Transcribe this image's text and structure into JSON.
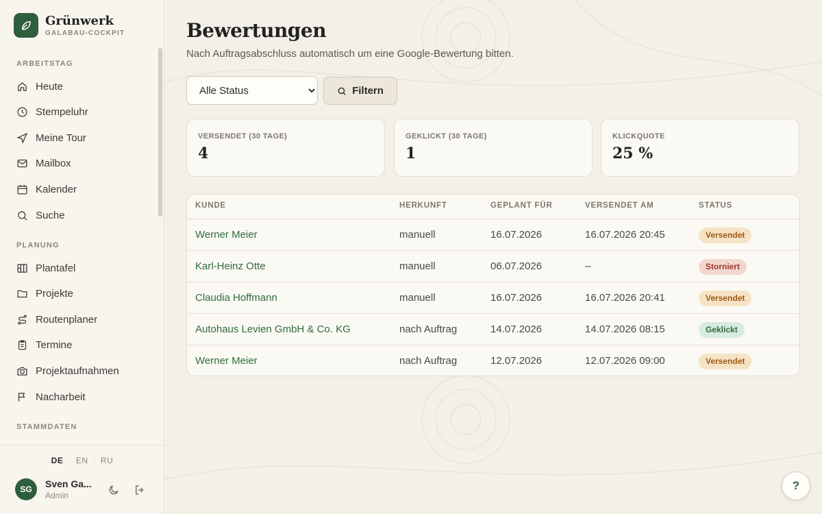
{
  "brand": {
    "name": "Grünwerk",
    "subtitle": "GALABAU-COCKPIT"
  },
  "sidebar": {
    "sections": [
      {
        "label": "ARBEITSTAG",
        "items": [
          "Heute",
          "Stempeluhr",
          "Meine Tour",
          "Mailbox",
          "Kalender",
          "Suche"
        ]
      },
      {
        "label": "PLANUNG",
        "items": [
          "Plantafel",
          "Projekte",
          "Routenplaner",
          "Termine",
          "Projektaufnahmen",
          "Nacharbeit"
        ]
      },
      {
        "label": "STAMMDATEN",
        "items": []
      }
    ],
    "languages": [
      "DE",
      "EN",
      "RU"
    ],
    "active_language": "DE",
    "user": {
      "initials": "SG",
      "name": "Sven Ga...",
      "role": "Admin"
    }
  },
  "page": {
    "title": "Bewertungen",
    "subtitle": "Nach Auftragsabschluss automatisch um eine Google-Bewertung bitten.",
    "filter": {
      "select_value": "Alle Status",
      "button_label": "Filtern"
    }
  },
  "stats": [
    {
      "label": "VERSENDET (30 TAGE)",
      "value": "4"
    },
    {
      "label": "GEKLICKT (30 TAGE)",
      "value": "1"
    },
    {
      "label": "KLICKQUOTE",
      "value": "25 %"
    }
  ],
  "table": {
    "columns": [
      "KUNDE",
      "HERKUNFT",
      "GEPLANT FÜR",
      "VERSENDET AM",
      "STATUS"
    ],
    "rows": [
      {
        "kunde": "Werner Meier",
        "herkunft": "manuell",
        "geplant": "16.07.2026",
        "versendet": "16.07.2026 20:45",
        "status": "Versendet"
      },
      {
        "kunde": "Karl-Heinz Otte",
        "herkunft": "manuell",
        "geplant": "06.07.2026",
        "versendet": "–",
        "status": "Storniert"
      },
      {
        "kunde": "Claudia Hoffmann",
        "herkunft": "manuell",
        "geplant": "16.07.2026",
        "versendet": "16.07.2026 20:41",
        "status": "Versendet"
      },
      {
        "kunde": "Autohaus Levien GmbH & Co. KG",
        "herkunft": "nach Auftrag",
        "geplant": "14.07.2026",
        "versendet": "14.07.2026 08:15",
        "status": "Geklickt"
      },
      {
        "kunde": "Werner Meier",
        "herkunft": "nach Auftrag",
        "geplant": "12.07.2026",
        "versendet": "12.07.2026 09:00",
        "status": "Versendet"
      }
    ]
  },
  "help_label": "?",
  "colors": {
    "accent": "#2f5e3d",
    "link": "#2f6b3e",
    "background": "#f3f0e8"
  }
}
